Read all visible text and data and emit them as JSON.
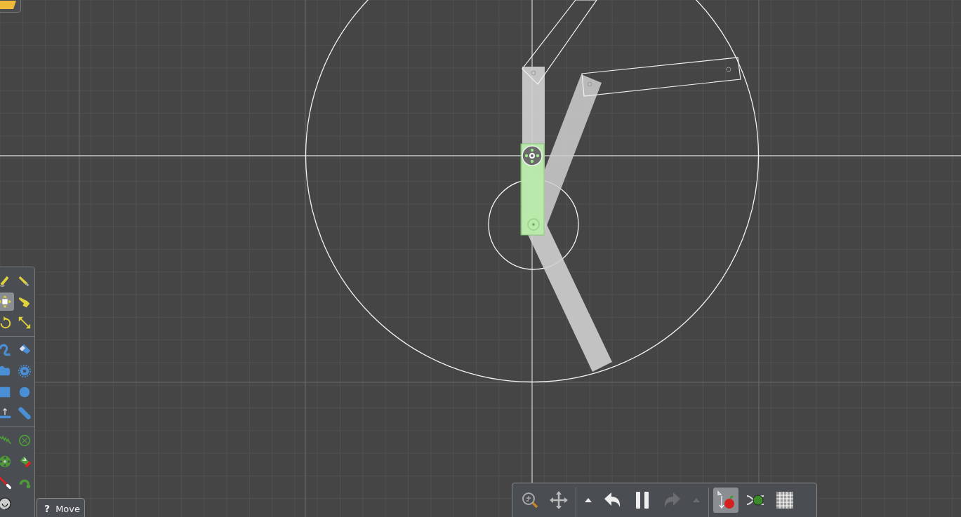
{
  "tool_groups": [
    {
      "tools": [
        {
          "kind": "sketch",
          "selected": false
        },
        {
          "kind": "knife",
          "selected": false
        },
        {
          "kind": "move",
          "selected": true
        },
        {
          "kind": "drag",
          "selected": false
        },
        {
          "kind": "rotate",
          "selected": false
        },
        {
          "kind": "scale",
          "selected": false
        }
      ]
    },
    {
      "tools": [
        {
          "kind": "brush",
          "selected": false
        },
        {
          "kind": "eraser",
          "selected": false
        },
        {
          "kind": "plane",
          "selected": false
        },
        {
          "kind": "gear",
          "selected": false
        },
        {
          "kind": "box",
          "selected": false
        },
        {
          "kind": "circle",
          "selected": false
        },
        {
          "kind": "ground",
          "selected": false
        },
        {
          "kind": "chain",
          "selected": false
        }
      ]
    },
    {
      "tools": [
        {
          "kind": "spring",
          "selected": false
        },
        {
          "kind": "fixate",
          "selected": false
        },
        {
          "kind": "hinge",
          "selected": false
        },
        {
          "kind": "tracer",
          "selected": false
        },
        {
          "kind": "laser",
          "selected": false
        },
        {
          "kind": "thruster",
          "selected": false
        },
        {
          "kind": "texture",
          "selected": false
        }
      ]
    }
  ],
  "tooltip": {
    "icon": "?",
    "text": "Move"
  },
  "toolbar": {
    "groups": [
      {
        "buttons": [
          {
            "kind": "zoom",
            "on": false,
            "disabled": false
          },
          {
            "kind": "pan",
            "on": false,
            "disabled": false
          }
        ]
      },
      {
        "buttons": [
          {
            "kind": "menu",
            "on": false,
            "disabled": false
          },
          {
            "kind": "undo",
            "on": false,
            "disabled": false
          },
          {
            "kind": "pause",
            "on": false,
            "disabled": false
          },
          {
            "kind": "redo",
            "on": false,
            "disabled": true
          },
          {
            "kind": "menu",
            "on": false,
            "disabled": true
          }
        ]
      },
      {
        "buttons": [
          {
            "kind": "gravity",
            "on": true,
            "disabled": false
          },
          {
            "kind": "air",
            "on": false,
            "disabled": false
          },
          {
            "kind": "grid",
            "on": false,
            "disabled": false
          }
        ]
      }
    ]
  }
}
